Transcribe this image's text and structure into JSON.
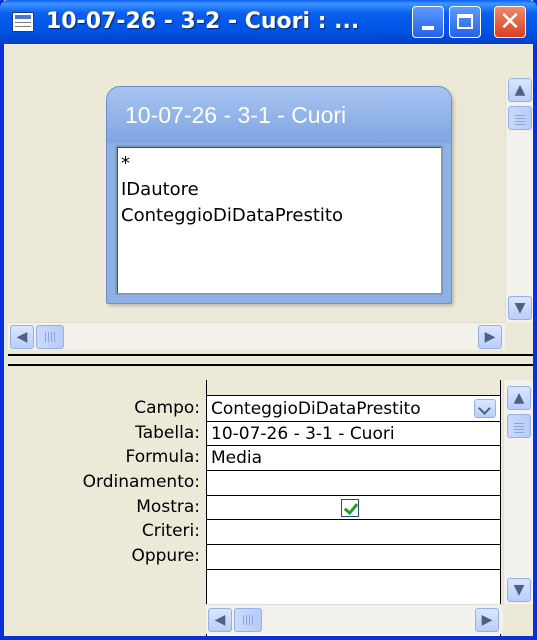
{
  "window": {
    "title": "10-07-26 - 3-2 - Cuori : ...",
    "controls": {
      "minimize": "minimize",
      "maximize": "maximize",
      "close": "✕"
    }
  },
  "table_pane": {
    "table": {
      "title": "10-07-26 - 3-1 - Cuori",
      "fields": [
        "*",
        "IDautore",
        "ConteggioDiDataPrestito"
      ]
    }
  },
  "design_grid": {
    "row_labels": {
      "field": "Campo:",
      "table": "Tabella:",
      "total": "Formula:",
      "sort": "Ordinamento:",
      "show": "Mostra:",
      "criteria": "Criteri:",
      "or": "Oppure:"
    },
    "column": {
      "field": "ConteggioDiDataPrestito",
      "table": "10-07-26 - 3-1 - Cuori",
      "total": "Media",
      "sort": "",
      "show_checked": true,
      "criteria": "",
      "or": ""
    }
  },
  "icons": {
    "app": "access-query-icon",
    "scroll_up": "▲",
    "scroll_down": "▼",
    "scroll_left": "◀",
    "scroll_right": "▶"
  }
}
